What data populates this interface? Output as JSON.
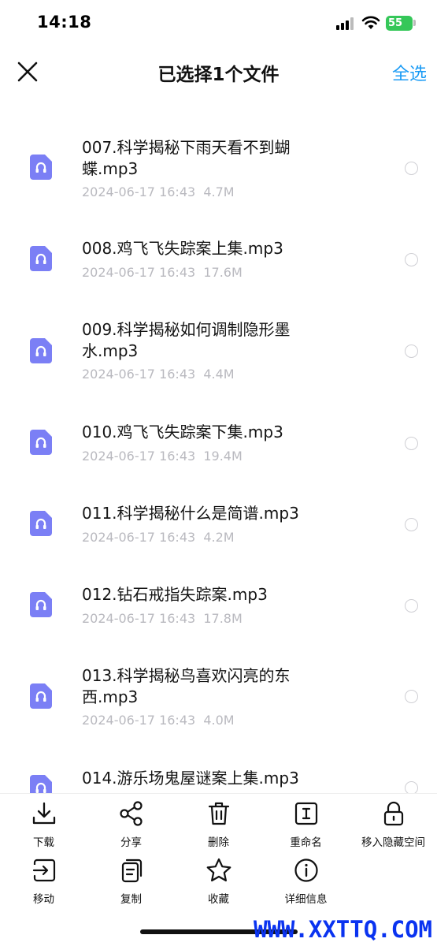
{
  "status": {
    "time": "14:18",
    "battery": "55"
  },
  "header": {
    "title": "已选择1个文件",
    "select_all": "全选"
  },
  "files": [
    {
      "name": "007.科学揭秘下雨天看不到蝴蝶.mp3",
      "date": "2024-06-17 16:43",
      "size": "4.7M"
    },
    {
      "name": "008.鸡飞飞失踪案上集.mp3",
      "date": "2024-06-17 16:43",
      "size": "17.6M"
    },
    {
      "name": "009.科学揭秘如何调制隐形墨水.mp3",
      "date": "2024-06-17 16:43",
      "size": "4.4M"
    },
    {
      "name": "010.鸡飞飞失踪案下集.mp3",
      "date": "2024-06-17 16:43",
      "size": "19.4M"
    },
    {
      "name": "011.科学揭秘什么是简谱.mp3",
      "date": "2024-06-17 16:43",
      "size": "4.2M"
    },
    {
      "name": "012.钻石戒指失踪案.mp3",
      "date": "2024-06-17 16:43",
      "size": "17.8M"
    },
    {
      "name": "013.科学揭秘鸟喜欢闪亮的东西.mp3",
      "date": "2024-06-17 16:43",
      "size": "4.0M"
    },
    {
      "name": "014.游乐场鬼屋谜案上集.mp3",
      "date": "",
      "size": ""
    }
  ],
  "toolbar": {
    "download": "下载",
    "share": "分享",
    "delete": "删除",
    "rename": "重命名",
    "hide": "移入隐藏空间",
    "move": "移动",
    "copy": "复制",
    "favorite": "收藏",
    "details": "详细信息"
  },
  "watermark": "WWW.XXTTQ.COM",
  "colors": {
    "accent": "#1a9bf5",
    "icon_bg": "#7b7ff5",
    "meta": "#b9b9bf",
    "watermark": "#0a33f0"
  }
}
